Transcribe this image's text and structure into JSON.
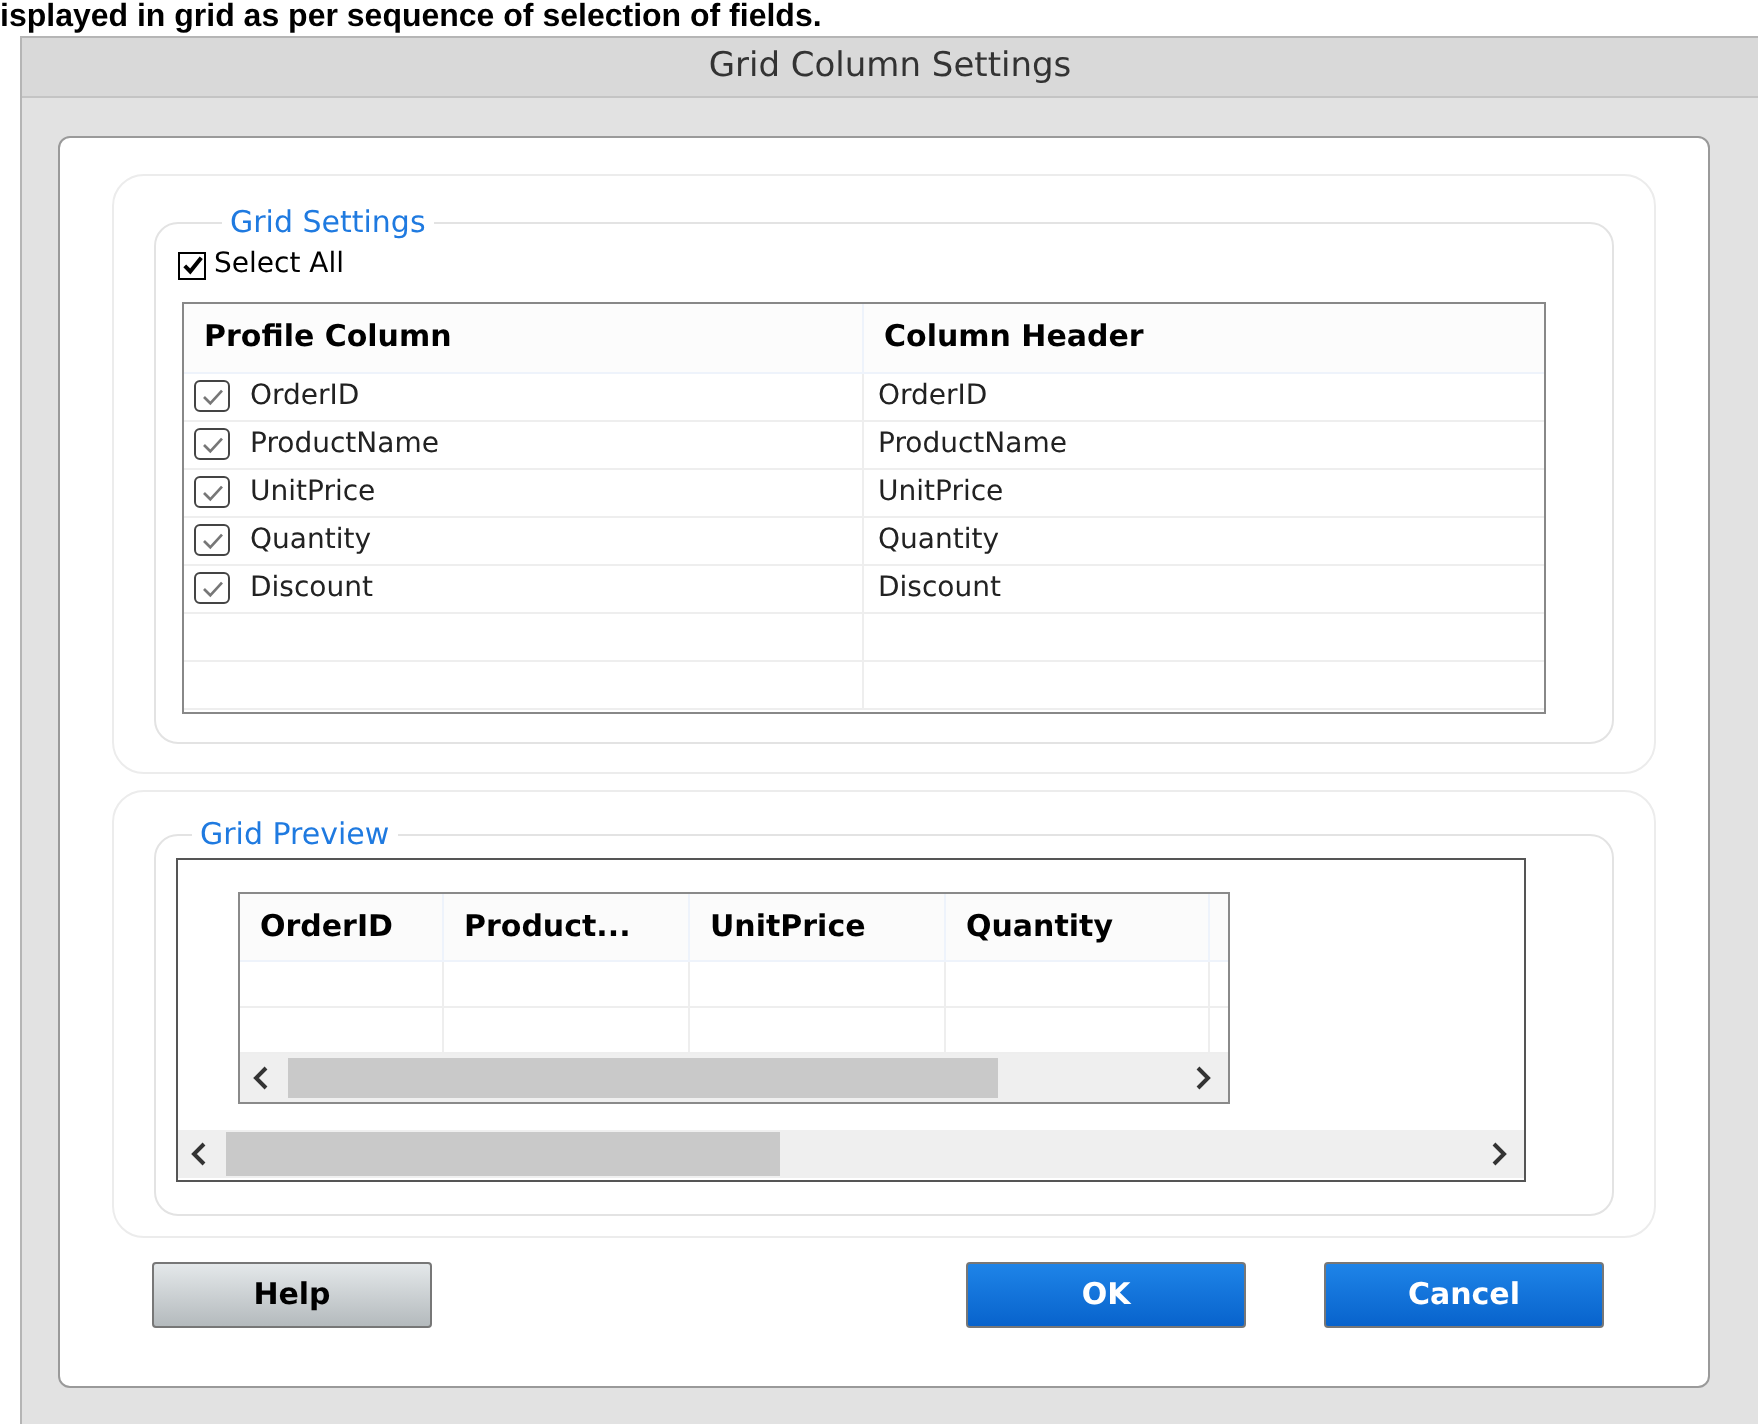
{
  "caption": "isplayed in grid as per sequence of selection of fields.",
  "window": {
    "title": "Grid Column Settings"
  },
  "grid_settings": {
    "legend": "Grid Settings",
    "select_all": {
      "label": "Select All",
      "checked": true
    },
    "table": {
      "columns": [
        "Profile Column",
        "Column Header"
      ],
      "rows": [
        {
          "name": "OrderID",
          "header": "OrderID",
          "checked": true
        },
        {
          "name": "ProductName",
          "header": "ProductName",
          "checked": true
        },
        {
          "name": "UnitPrice",
          "header": "UnitPrice",
          "checked": true
        },
        {
          "name": "Quantity",
          "header": "Quantity",
          "checked": true
        },
        {
          "name": "Discount",
          "header": "Discount",
          "checked": true
        }
      ]
    }
  },
  "grid_preview": {
    "legend": "Grid Preview",
    "columns": [
      "OrderID",
      "Product...",
      "UnitPrice",
      "Quantity"
    ]
  },
  "buttons": [
    {
      "label": "Help",
      "kind": "secondary"
    },
    {
      "label": "OK",
      "kind": "primary"
    },
    {
      "label": "Cancel",
      "kind": "primary"
    }
  ]
}
